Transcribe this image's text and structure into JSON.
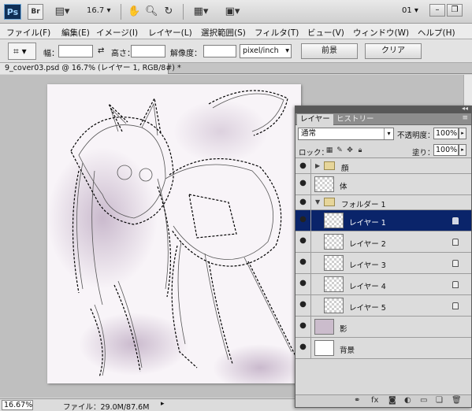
{
  "appbar": {
    "ps_label": "Ps",
    "br_label": "Br",
    "zoom_value": "16.7",
    "workspace": "01"
  },
  "menu": [
    "ファイル(F)",
    "編集(E)",
    "イメージ(I)",
    "レイヤー(L)",
    "選択範囲(S)",
    "フィルタ(T)",
    "ビュー(V)",
    "ウィンドウ(W)",
    "ヘルプ(H)"
  ],
  "options": {
    "width_label": "幅：",
    "height_label": "高さ：",
    "resolution_label": "解像度：",
    "unit_value": "pixel/inch",
    "front_button": "前景",
    "clear_button": "クリア"
  },
  "document": {
    "tab_title": "9_cover03.psd @ 16.7% (レイヤー 1, RGB/8#) *"
  },
  "status": {
    "zoom": "16.67%",
    "file_info": "ファイル：29.0M/87.6M"
  },
  "layers_panel": {
    "tabs": [
      "レイヤー",
      "ヒストリー"
    ],
    "blend_mode": "通常",
    "opacity_label": "不透明度：",
    "opacity_value": "100%",
    "lock_label": "ロック：",
    "fill_label": "塗り：",
    "fill_value": "100%",
    "layers": [
      {
        "name": "顔",
        "kind": "group-collapsed"
      },
      {
        "name": "体",
        "kind": "layer"
      },
      {
        "name": "フォルダー 1",
        "kind": "group-open"
      },
      {
        "name": "レイヤー 1",
        "kind": "child",
        "selected": true
      },
      {
        "name": "レイヤー 2",
        "kind": "child"
      },
      {
        "name": "レイヤー 3",
        "kind": "child"
      },
      {
        "name": "レイヤー 4",
        "kind": "child"
      },
      {
        "name": "レイヤー 5",
        "kind": "child"
      },
      {
        "name": "影",
        "kind": "layer"
      },
      {
        "name": "背景",
        "kind": "background"
      }
    ]
  },
  "colors": {
    "selected_layer": "#0a246a",
    "canvas_bg": "#bfbfbf",
    "art_tint": "#a48aaa"
  }
}
